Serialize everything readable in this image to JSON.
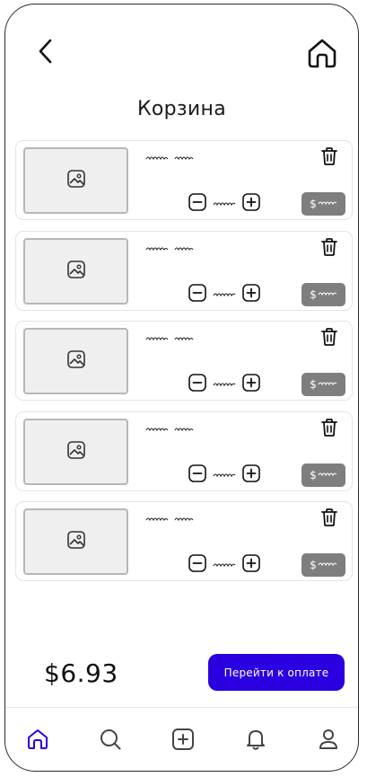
{
  "header": {
    "title": "Корзина"
  },
  "cart": {
    "items": [
      {
        "name_icon": "scribble-text",
        "qty_icon": "scribble-text",
        "price_currency": "$"
      },
      {
        "name_icon": "scribble-text",
        "qty_icon": "scribble-text",
        "price_currency": "$"
      },
      {
        "name_icon": "scribble-text",
        "qty_icon": "scribble-text",
        "price_currency": "$"
      },
      {
        "name_icon": "scribble-text",
        "qty_icon": "scribble-text",
        "price_currency": "$"
      },
      {
        "name_icon": "scribble-text",
        "qty_icon": "scribble-text",
        "price_currency": "$"
      }
    ]
  },
  "footer": {
    "total": "$6.93",
    "checkout_label": "Перейти к оплате"
  },
  "nav": {
    "items": [
      "home-icon",
      "search-icon",
      "add-icon",
      "bell-icon",
      "profile-icon"
    ],
    "active": "home-icon"
  },
  "colors": {
    "accent": "#2a00e0",
    "price_badge": "#7e7e7e",
    "thumb_bg": "#efefef"
  }
}
